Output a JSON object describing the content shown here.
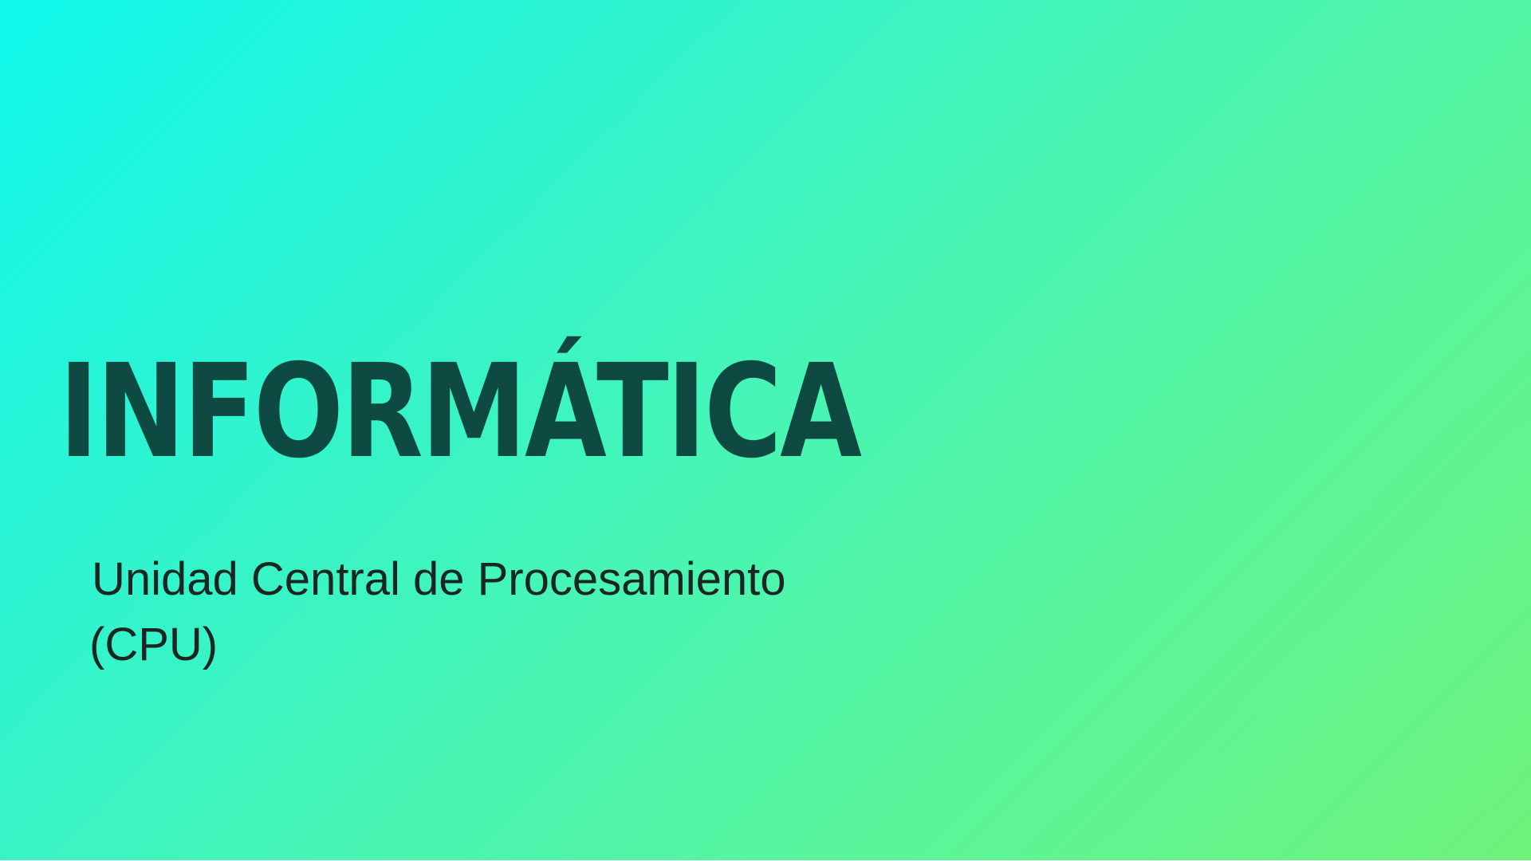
{
  "slide": {
    "title": "INFORMÁTICA",
    "subtitle_line1": "Unidad Central de Procesamiento",
    "subtitle_line2": "(CPU)"
  },
  "colors": {
    "gradient_start": "#0ff8ec",
    "gradient_end": "#6ef27a",
    "title_color": "#0f4a42",
    "subtitle_color": "#1b2622"
  }
}
